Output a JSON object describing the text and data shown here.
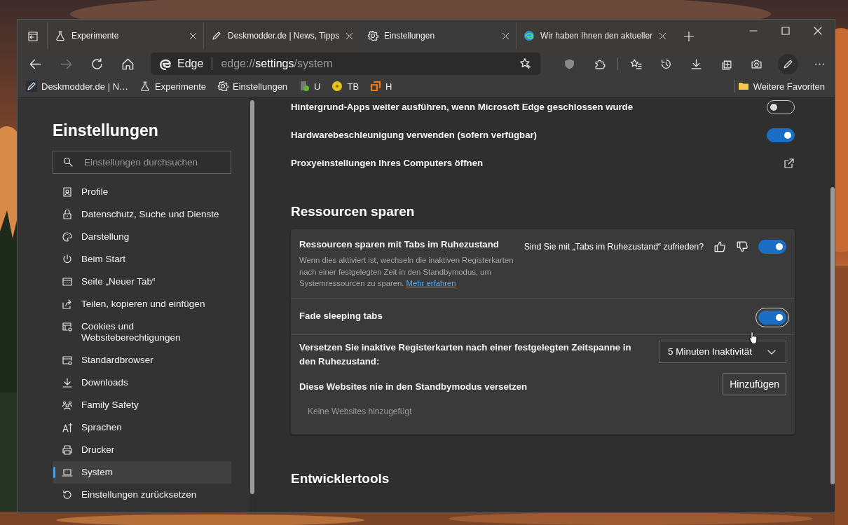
{
  "tabs": [
    {
      "title": "Experimente",
      "selected": false
    },
    {
      "title": "Deskmodder.de | News, Tipps",
      "selected": false
    },
    {
      "title": "Einstellungen",
      "selected": true
    },
    {
      "title": "Wir haben Ihnen den aktueller",
      "selected": false
    }
  ],
  "toolbar": {
    "forward": {
      "disabled": true
    }
  },
  "address": {
    "brand": "Edge",
    "scheme": "edge://",
    "host": "settings",
    "path": "/system"
  },
  "favorites_bar": {
    "items": [
      {
        "label": "Deskmodder.de | N…"
      },
      {
        "label": "Experimente"
      },
      {
        "label": "Einstellungen"
      },
      {
        "label": "U"
      },
      {
        "label": "TB"
      },
      {
        "label": "H"
      }
    ],
    "more": "Weitere Favoriten"
  },
  "sidebar": {
    "title": "Einstellungen",
    "search": {
      "placeholder": "Einstellungen durchsuchen"
    },
    "items": [
      {
        "label": "Profile",
        "selected": false
      },
      {
        "label": "Datenschutz, Suche und Dienste",
        "selected": false
      },
      {
        "label": "Darstellung",
        "selected": false
      },
      {
        "label": "Beim Start",
        "selected": false
      },
      {
        "label": "Seite „Neuer Tab“",
        "selected": false
      },
      {
        "label": "Teilen, kopieren und einfügen",
        "selected": false
      },
      {
        "label": "Cookies und Websiteberechtigungen",
        "selected": false
      },
      {
        "label": "Standardbrowser",
        "selected": false
      },
      {
        "label": "Downloads",
        "selected": false
      },
      {
        "label": "Family Safety",
        "selected": false
      },
      {
        "label": "Sprachen",
        "selected": false
      },
      {
        "label": "Drucker",
        "selected": false
      },
      {
        "label": "System",
        "selected": true
      },
      {
        "label": "Einstellungen zurücksetzen",
        "selected": false
      }
    ]
  },
  "general_rows": [
    {
      "kind": "toggle",
      "label": "Hintergrund-Apps weiter ausführen, wenn Microsoft Edge geschlossen wurde",
      "on": false
    },
    {
      "kind": "toggle",
      "label": "Hardwarebeschleunigung verwenden (sofern verfügbar)",
      "on": true
    },
    {
      "kind": "link",
      "label": "Proxyeinstellungen Ihres Computers öffnen"
    }
  ],
  "sections": [
    {
      "title": "Ressourcen sparen",
      "card": {
        "rows": [
          {
            "kind": "toggle",
            "label": "Ressourcen sparen mit Tabs im Ruhezustand",
            "description": "Wenn dies aktiviert ist, wechseln die inaktiven Registerkarten nach einer festgelegten Zeit in den Standbymodus, um Systemressourcen zu sparen.",
            "link": "Mehr erfahren",
            "feedback": "Sind Sie mit „Tabs im Ruhezustand“ zufrieden?",
            "on": true,
            "focused": false
          },
          {
            "kind": "toggle",
            "label": "Fade sleeping tabs",
            "on": true,
            "focused": true
          },
          {
            "kind": "select",
            "label": "Versetzen Sie inaktive Registerkarten nach einer festgelegten Zeitspanne in den Ruhezustand:",
            "value": "5 Minuten Inaktivität"
          },
          {
            "kind": "list",
            "label": "Diese Websites nie in den Standbymodus versetzen",
            "button": "Hinzufügen",
            "empty": "Keine Websites hinzugefügt"
          }
        ]
      }
    },
    {
      "title": "Entwicklertools"
    }
  ]
}
